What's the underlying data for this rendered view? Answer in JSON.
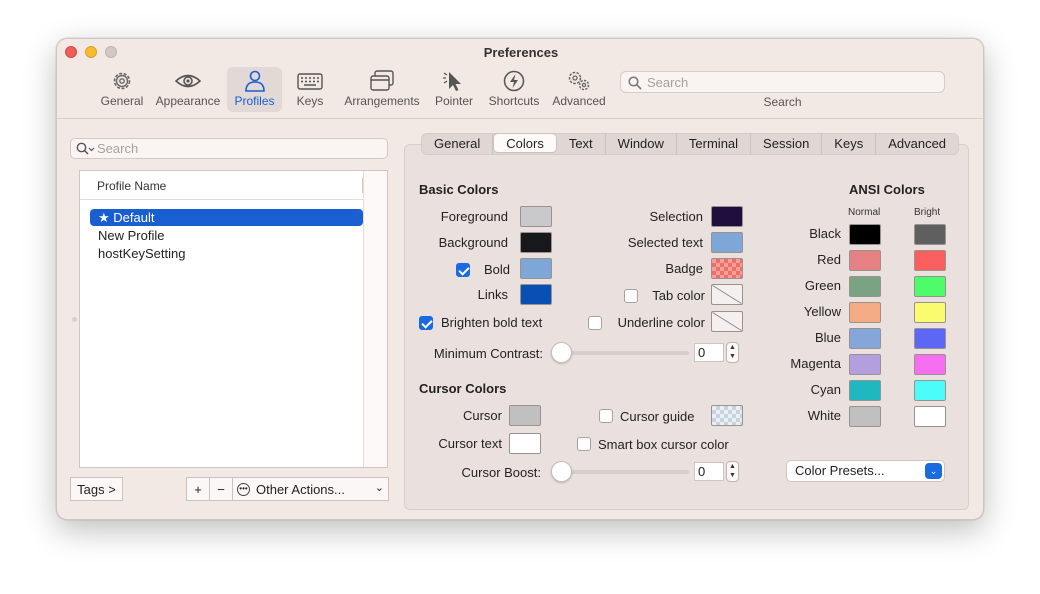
{
  "window": {
    "title": "Preferences"
  },
  "toolbar": {
    "items": [
      {
        "label": "General",
        "icon": "gear-icon"
      },
      {
        "label": "Appearance",
        "icon": "eye-icon"
      },
      {
        "label": "Profiles",
        "icon": "person-icon",
        "active": true
      },
      {
        "label": "Keys",
        "icon": "keyboard-icon"
      },
      {
        "label": "Arrangements",
        "icon": "windows-icon"
      },
      {
        "label": "Pointer",
        "icon": "pointer-icon"
      },
      {
        "label": "Shortcuts",
        "icon": "bolt-icon"
      },
      {
        "label": "Advanced",
        "icon": "gears-icon"
      }
    ],
    "search": {
      "placeholder": "Search",
      "label": "Search"
    }
  },
  "profiles": {
    "search_placeholder": "Search",
    "column_header": "Profile Name",
    "rows": [
      "★ Default",
      "New Profile",
      "hostKeySetting"
    ],
    "selected_index": 0,
    "tags_button": "Tags >",
    "add_button": "+",
    "remove_button": "−",
    "other_actions": "Other Actions..."
  },
  "tabs": [
    "General",
    "Colors",
    "Text",
    "Window",
    "Terminal",
    "Session",
    "Keys",
    "Advanced"
  ],
  "active_tab": "Colors",
  "basic_colors": {
    "title": "Basic Colors",
    "foreground": {
      "label": "Foreground",
      "color": "#c9c9cb"
    },
    "background": {
      "label": "Background",
      "color": "#17181c"
    },
    "bold": {
      "label": "Bold",
      "color": "#7ea7d8",
      "checked": true
    },
    "links": {
      "label": "Links",
      "color": "#0a4fb3"
    },
    "brighten_bold": {
      "label": "Brighten bold text",
      "checked": true
    },
    "selection": {
      "label": "Selection",
      "color": "#1e0d3d"
    },
    "selected_text": {
      "label": "Selected text",
      "color": "#7ea7d8"
    },
    "badge": {
      "label": "Badge"
    },
    "tab_color": {
      "label": "Tab color",
      "checked": false
    },
    "underline_color": {
      "label": "Underline color",
      "checked": false
    },
    "min_contrast": {
      "label": "Minimum Contrast:",
      "value": "0"
    }
  },
  "cursor_colors": {
    "title": "Cursor Colors",
    "cursor": {
      "label": "Cursor",
      "color": "#c0c0c0"
    },
    "cursor_text": {
      "label": "Cursor text",
      "color": "#ffffff"
    },
    "cursor_guide": {
      "label": "Cursor guide",
      "checked": false
    },
    "smart_box": {
      "label": "Smart box cursor color",
      "checked": false
    },
    "boost": {
      "label": "Cursor Boost:",
      "value": "0"
    }
  },
  "ansi": {
    "title": "ANSI Colors",
    "normal_label": "Normal",
    "bright_label": "Bright",
    "rows": [
      {
        "name": "Black",
        "normal": "#000000",
        "bright": "#5f5f5f"
      },
      {
        "name": "Red",
        "normal": "#e58083",
        "bright": "#f85f5e"
      },
      {
        "name": "Green",
        "normal": "#79a382",
        "bright": "#4dfb6b"
      },
      {
        "name": "Yellow",
        "normal": "#f5ab83",
        "bright": "#fafb6e"
      },
      {
        "name": "Blue",
        "normal": "#86a6d9",
        "bright": "#5c67f6"
      },
      {
        "name": "Magenta",
        "normal": "#b39fe0",
        "bright": "#f66ff0"
      },
      {
        "name": "Cyan",
        "normal": "#1fb8c1",
        "bright": "#4bfcf9"
      },
      {
        "name": "White",
        "normal": "#c0c0c0",
        "bright": "#ffffff"
      }
    ]
  },
  "color_presets": "Color Presets..."
}
